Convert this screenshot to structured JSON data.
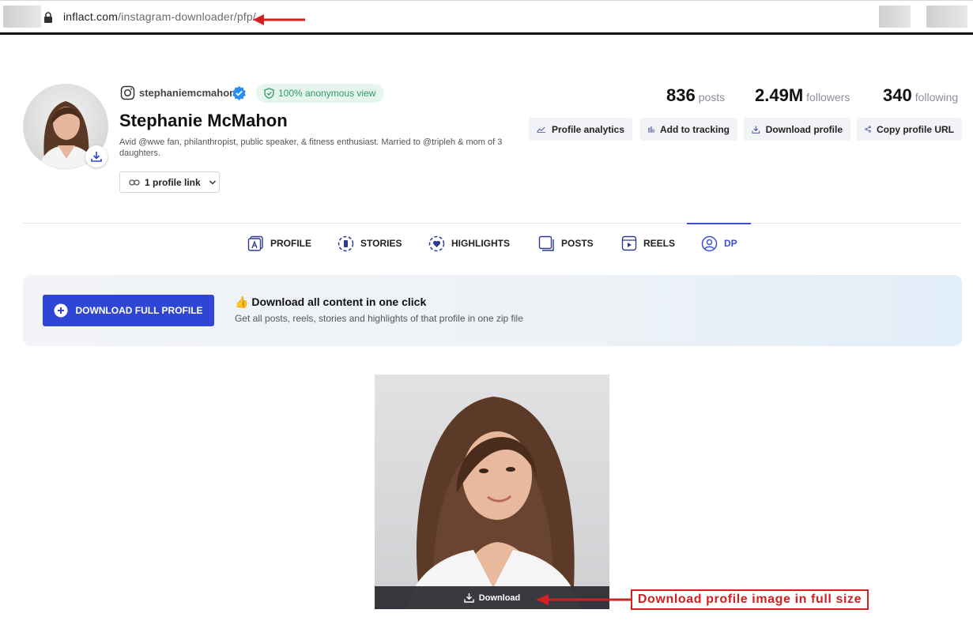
{
  "browser": {
    "url_host": "inflact.com",
    "url_path": "/instagram-downloader/pfp/"
  },
  "profile": {
    "username": "stephaniemcmahon",
    "anonymous_badge": "100% anonymous view",
    "full_name": "Stephanie McMahon",
    "bio": "Avid @wwe fan, philanthropist, public speaker, & fitness enthusiast. Married to @tripleh & mom of 3 daughters.",
    "profile_link": "1 profile link"
  },
  "stats": [
    {
      "value": "836",
      "label": "posts"
    },
    {
      "value": "2.49M",
      "label": "followers"
    },
    {
      "value": "340",
      "label": "following"
    }
  ],
  "actions": [
    {
      "label": "Profile analytics",
      "icon": "chart-line-icon"
    },
    {
      "label": "Add to tracking",
      "icon": "bar-chart-icon"
    },
    {
      "label": "Download profile",
      "icon": "download-icon"
    },
    {
      "label": "Copy profile URL",
      "icon": "share-icon"
    }
  ],
  "tabs": [
    {
      "label": "PROFILE",
      "icon": "profile-tab-icon",
      "active": false
    },
    {
      "label": "STORIES",
      "icon": "stories-tab-icon",
      "active": false
    },
    {
      "label": "HIGHLIGHTS",
      "icon": "highlights-tab-icon",
      "active": false
    },
    {
      "label": "POSTS",
      "icon": "posts-tab-icon",
      "active": false
    },
    {
      "label": "REELS",
      "icon": "reels-tab-icon",
      "active": false
    },
    {
      "label": "DP",
      "icon": "dp-tab-icon",
      "active": true
    }
  ],
  "banner": {
    "button_label": "DOWNLOAD FULL PROFILE",
    "title": "Download all content in one click",
    "emoji": "👍",
    "subtitle": "Get all posts, reels, stories and highlights of that profile in one zip file"
  },
  "photo": {
    "download_label": "Download"
  },
  "annotation": {
    "callout_text": "Download profile image in full size"
  },
  "colors": {
    "accent": "#2f45d4",
    "annotation_red": "#d21f1f",
    "badge_green": "#2f9a62"
  }
}
